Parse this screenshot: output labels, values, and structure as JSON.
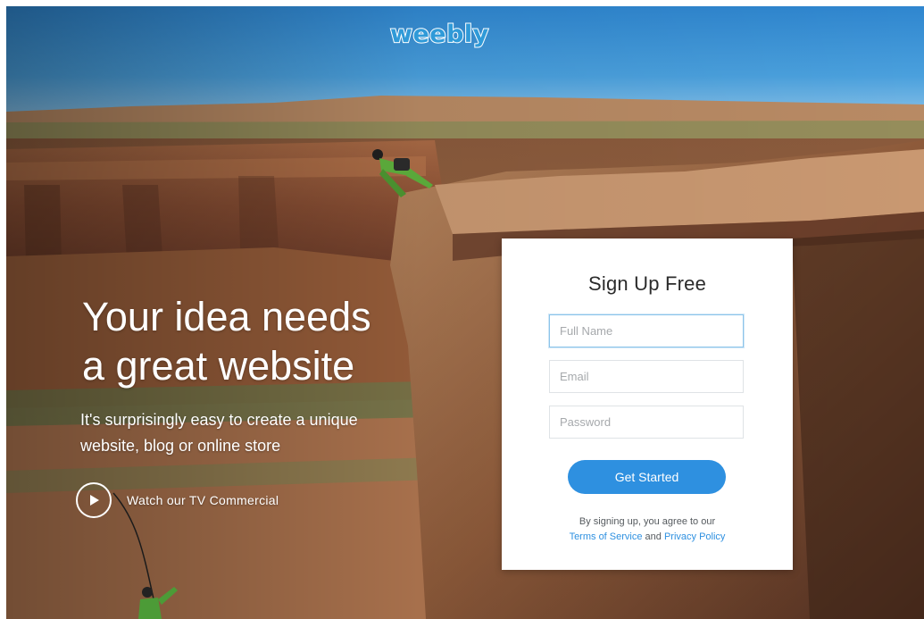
{
  "header": {
    "logo_text": "weebly"
  },
  "hero": {
    "headline_line1": "Your idea needs",
    "headline_line2": "a great website",
    "subline_line1": "It's surprisingly easy to create a unique",
    "subline_line2": "website, blog or online store",
    "watch_label": "Watch our TV Commercial",
    "play_icon": "play-icon"
  },
  "signup": {
    "title": "Sign Up Free",
    "full_name_placeholder": "Full Name",
    "full_name_value": "",
    "email_placeholder": "Email",
    "email_value": "",
    "password_placeholder": "Password",
    "password_value": "",
    "submit_label": "Get Started",
    "legal_prefix": "By signing up, you agree to our",
    "terms_link": "Terms of Service",
    "legal_and": "and",
    "privacy_link": "Privacy Policy"
  },
  "colors": {
    "accent": "#2e90e0",
    "logo": "#2f9ad8",
    "card_bg": "#ffffff"
  }
}
